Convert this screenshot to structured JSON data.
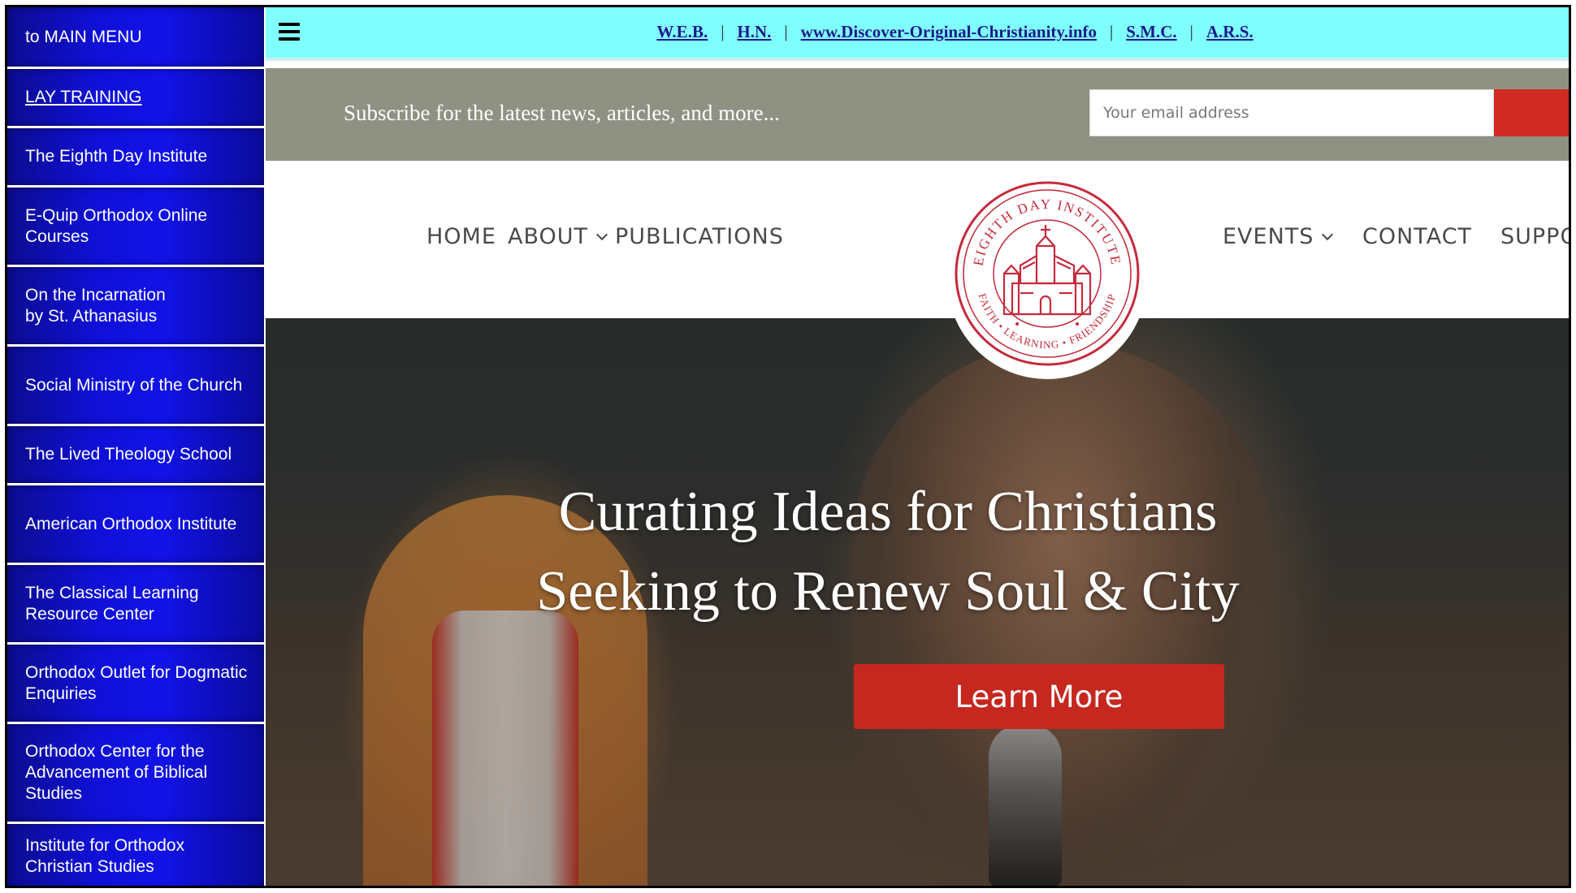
{
  "sidebar": {
    "items": [
      {
        "label": "to MAIN MENU"
      },
      {
        "label": "LAY TRAINING"
      },
      {
        "label": "The Eighth Day Institute"
      },
      {
        "label": "E-Quip Orthodox Online Courses"
      },
      {
        "label": "On the Incarnation by St. Athanasius"
      },
      {
        "label": "Social Ministry of the Church"
      },
      {
        "label": "The Lived Theology School"
      },
      {
        "label": "American Orthodox Institute"
      },
      {
        "label": "The Classical Learning Resource Center"
      },
      {
        "label": "Orthodox Outlet for Dogmatic Enquiries"
      },
      {
        "label": "Orthodox Center for the Advancement of Biblical Studies"
      },
      {
        "label": "Institute for Orthodox Christian Studies"
      }
    ]
  },
  "topbar": {
    "links": [
      "W.E.B.",
      "H.N.",
      "www.Discover-Original-Christianity.info",
      "S.M.C.",
      "A.R.S."
    ],
    "separator": "|",
    "menu_icon": "hamburger-menu-icon"
  },
  "subscribe": {
    "text": "Subscribe for the latest news, articles, and more...",
    "email_placeholder": "Your email address"
  },
  "nav": {
    "home": "HOME",
    "about": "ABOUT",
    "publications": "PUBLICATIONS",
    "events": "EVENTS",
    "contact": "CONTACT",
    "support": "SUPPO"
  },
  "logo": {
    "ring_text_top": "EIGHTH DAY INSTITUTE",
    "ring_text_bottom": "FAITH • LEARNING • FRIENDSHIP",
    "color": "#c42b3c"
  },
  "hero": {
    "title_line1": "Curating Ideas for Christians",
    "title_line2": "Seeking to Renew Soul & City",
    "button": "Learn More"
  },
  "colors": {
    "sidebar_blue": "#1212e8",
    "topbar_cyan": "#80ffff",
    "subscribe_bar": "#8f9283",
    "accent_red": "#c6271f"
  }
}
